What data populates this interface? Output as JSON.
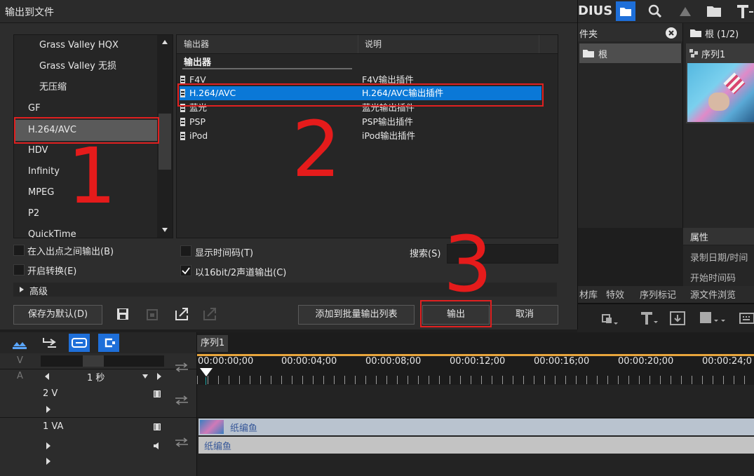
{
  "dialog": {
    "title": "输出到文件",
    "formats": [
      "Grass Valley HQX",
      "Grass Valley 无损",
      "无压缩",
      "GF",
      "H.264/AVC",
      "HDV",
      "Infinity",
      "MPEG",
      "P2",
      "QuickTime"
    ],
    "header_col1": "输出器",
    "header_col2": "说明",
    "group_label": "输出器",
    "exporters": [
      {
        "name": "F4V",
        "desc": "F4V输出插件"
      },
      {
        "name": "H.264/AVC",
        "desc": "H.264/AVC输出插件"
      },
      {
        "name": "蓝光",
        "desc": "蓝光输出插件"
      },
      {
        "name": "PSP",
        "desc": "PSP输出插件"
      },
      {
        "name": "iPod",
        "desc": "iPod输出插件"
      }
    ],
    "cb_inout": "在入出点之间输出(B)",
    "cb_convert": "开启转换(E)",
    "cb_timecode": "显示时间码(T)",
    "cb_16bit": "以16bit/2声道输出(C)",
    "search_label": "搜索(S)",
    "advanced_label": "高级",
    "save_default": "保存为默认(D)",
    "add_batch": "添加到批量输出列表",
    "export_btn": "输出",
    "cancel_btn": "取消"
  },
  "annotations": [
    "1",
    "2",
    "3"
  ],
  "app": {
    "logo": "DIUS",
    "folder_label": "件夹",
    "root_item": "根",
    "root_count": "根 (1/2)",
    "sequence_item": "序列1",
    "properties_label": "属性",
    "record_date": "录制日期/时间",
    "start_tc": "开始时间码",
    "bottom_tabs": [
      "材库",
      "特效",
      "序列标记",
      "源文件浏览"
    ]
  },
  "timeline": {
    "sequence_tab": "序列1",
    "scale": "1 秒",
    "v_label": "V",
    "a_label": "A",
    "timecodes": [
      "00:00:00;00",
      "00:00:04;00",
      "00:00:08;00",
      "00:00:12;00",
      "00:00:16;00",
      "00:00:20;00",
      "00:00:24;0"
    ],
    "track2": "2 V",
    "track1": "1 VA",
    "clip_video": "纸编鱼",
    "clip_audio": "纸编鱼"
  },
  "colors": {
    "selected": "#0a78d7",
    "accent": "#e51b1b",
    "timeline_bar": "#e8a53c",
    "clip": "#b9c3cf"
  }
}
